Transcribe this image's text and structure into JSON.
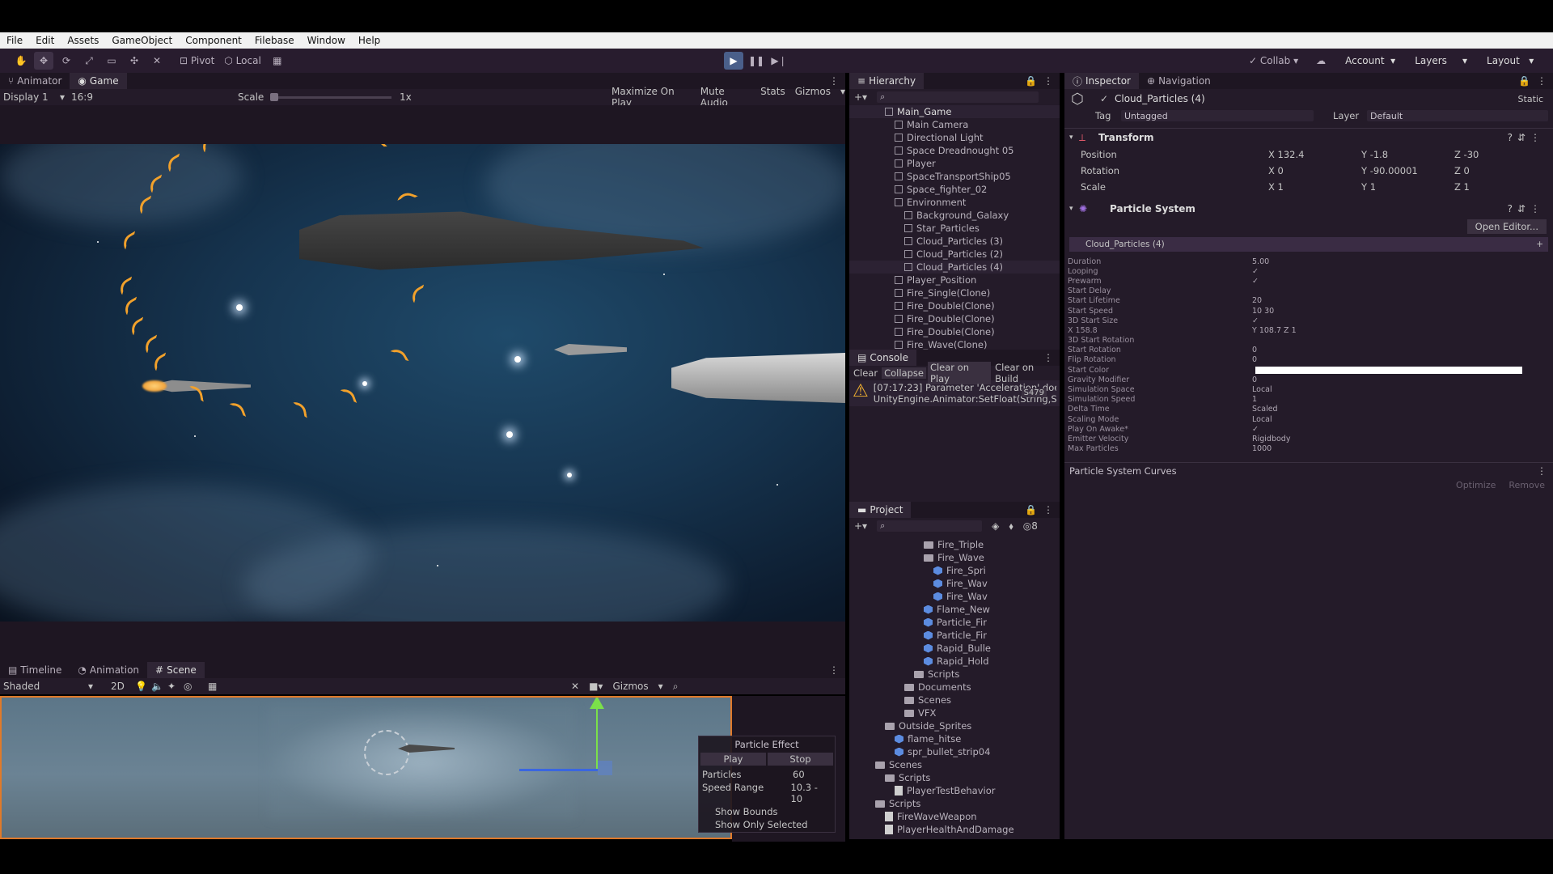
{
  "menu": [
    "File",
    "Edit",
    "Assets",
    "GameObject",
    "Component",
    "Filebase",
    "Window",
    "Help"
  ],
  "toolbar": {
    "pivot": "Pivot",
    "local": "Local",
    "collab": "Collab",
    "account": "Account",
    "layers": "Layers",
    "layout": "Layout"
  },
  "game_tabs": {
    "animator": "Animator",
    "game": "Game"
  },
  "game_bar": {
    "display": "Display 1",
    "aspect": "16:9",
    "scale_label": "Scale",
    "scale_value": "1x",
    "maximize": "Maximize On Play",
    "mute": "Mute Audio",
    "stats": "Stats",
    "gizmos": "Gizmos"
  },
  "hierarchy": {
    "title": "Hierarchy",
    "root": "Main_Game",
    "items": [
      "Main Camera",
      "Directional Light",
      "Space Dreadnought 05",
      "Player",
      "SpaceTransportShip05",
      "Space_fighter_02",
      "Environment",
      "Background_Galaxy",
      "Star_Particles",
      "Cloud_Particles (3)",
      "Cloud_Particles (2)",
      "Cloud_Particles (4)",
      "Player_Position",
      "Fire_Single(Clone)",
      "Fire_Double(Clone)",
      "Fire_Double(Clone)",
      "Fire_Double(Clone)",
      "Fire_Wave(Clone)"
    ]
  },
  "console": {
    "title": "Console",
    "clear": "Clear",
    "collapse": "Collapse",
    "clear_on_play": "Clear on Play",
    "clear_on_build": "Clear on Build",
    "msg1": "[07:17:23] Parameter 'Acceleration' does",
    "msg2": "UnityEngine.Animator:SetFloat(String,Si",
    "count": "S479"
  },
  "project": {
    "title": "Project",
    "items": [
      {
        "t": "folder",
        "n": "Fire_Triple",
        "i": 6
      },
      {
        "t": "folder",
        "n": "Fire_Wave",
        "i": 6
      },
      {
        "t": "blue",
        "n": "Fire_Spri",
        "i": 7
      },
      {
        "t": "blue",
        "n": "Fire_Wav",
        "i": 7
      },
      {
        "t": "blue",
        "n": "Fire_Wav",
        "i": 7
      },
      {
        "t": "blue",
        "n": "Flame_New",
        "i": 6
      },
      {
        "t": "blue",
        "n": "Particle_Fir",
        "i": 6
      },
      {
        "t": "blue",
        "n": "Particle_Fir",
        "i": 6
      },
      {
        "t": "blue",
        "n": "Rapid_Bulle",
        "i": 6
      },
      {
        "t": "blue",
        "n": "Rapid_Hold",
        "i": 6
      },
      {
        "t": "folder",
        "n": "Scripts",
        "i": 5
      },
      {
        "t": "folder",
        "n": "Documents",
        "i": 4
      },
      {
        "t": "folder",
        "n": "Scenes",
        "i": 4
      },
      {
        "t": "folder",
        "n": "VFX",
        "i": 4
      },
      {
        "t": "folder",
        "n": "Outside_Sprites",
        "i": 2
      },
      {
        "t": "blue",
        "n": "flame_hitse",
        "i": 3
      },
      {
        "t": "blue",
        "n": "spr_bullet_strip04",
        "i": 3
      },
      {
        "t": "folder",
        "n": "Scenes",
        "i": 1
      },
      {
        "t": "folder",
        "n": "Scripts",
        "i": 2
      },
      {
        "t": "script",
        "n": "PlayerTestBehavior",
        "i": 3
      },
      {
        "t": "folder",
        "n": "Scripts",
        "i": 1
      },
      {
        "t": "script",
        "n": "FireWaveWeapon",
        "i": 2
      },
      {
        "t": "script",
        "n": "PlayerHealthAndDamage",
        "i": 2
      }
    ]
  },
  "inspector": {
    "tab_inspector": "Inspector",
    "tab_navigation": "Navigation",
    "object_name": "Cloud_Particles (4)",
    "static": "Static",
    "tag_label": "Tag",
    "tag_value": "Untagged",
    "layer_label": "Layer",
    "layer_value": "Default",
    "transform": {
      "title": "Transform",
      "position": "Position",
      "rotation": "Rotation",
      "scale": "Scale",
      "px": "132.4",
      "py": "-1.8",
      "pz": "-30",
      "rx": "0",
      "ry": "-90.00001",
      "rz": "0",
      "sx": "1",
      "sy": "1",
      "sz": "1"
    },
    "ps_title": "Particle System",
    "open_editor": "Open Editor...",
    "module_name": "Cloud_Particles (4)",
    "props": [
      [
        "Duration",
        "5.00"
      ],
      [
        "Looping",
        "✓"
      ],
      [
        "Prewarm",
        "✓"
      ],
      [
        "Start Delay",
        ""
      ],
      [
        "Start Lifetime",
        "20"
      ],
      [
        "Start Speed",
        "10                30"
      ],
      [
        "3D Start Size",
        "✓"
      ],
      [
        "X 158.8",
        "Y 108.7          Z 1"
      ],
      [
        "3D Start Rotation",
        ""
      ],
      [
        "Start Rotation",
        "0"
      ],
      [
        "Flip Rotation",
        "0"
      ],
      [
        "Start Color",
        ""
      ],
      [
        "Gravity Modifier",
        "0"
      ],
      [
        "Simulation Space",
        "Local"
      ],
      [
        "Simulation Speed",
        "1"
      ],
      [
        "Delta Time",
        "Scaled"
      ],
      [
        "Scaling Mode",
        "Local"
      ],
      [
        "Play On Awake*",
        "✓"
      ],
      [
        "Emitter Velocity",
        "Rigidbody"
      ],
      [
        "Max Particles",
        "1000"
      ]
    ],
    "curves": "Particle System Curves",
    "optimize": "Optimize",
    "remove": "Remove"
  },
  "scene_tabs": {
    "timeline": "Timeline",
    "animation": "Animation",
    "scene": "Scene"
  },
  "scene_bar": {
    "shading": "Shaded",
    "mode2d": "2D",
    "gizmos": "Gizmos"
  },
  "particle_effect": {
    "title": "Particle Effect",
    "play": "Play",
    "stop": "Stop",
    "particles_label": "Particles",
    "particles_value": "60",
    "speed_label": "Speed Range",
    "speed_value": "10.3 - 10",
    "bounds": "Show Bounds",
    "only_selected": "Show Only Selected"
  }
}
